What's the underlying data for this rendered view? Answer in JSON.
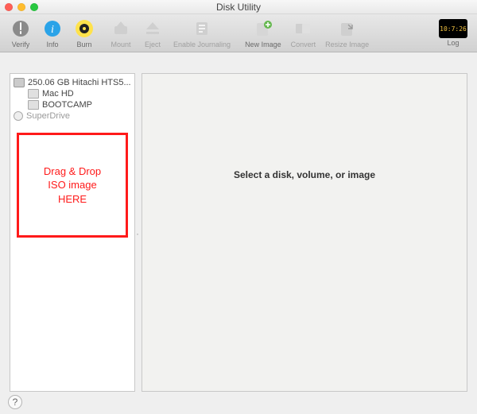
{
  "window": {
    "title": "Disk Utility"
  },
  "toolbar": {
    "verify": "Verify",
    "info": "Info",
    "burn": "Burn",
    "mount": "Mount",
    "eject": "Eject",
    "enable_journaling": "Enable Journaling",
    "new_image": "New Image",
    "convert": "Convert",
    "resize_image": "Resize Image",
    "log": "Log",
    "log_badge": "10:7:26"
  },
  "sidebar": {
    "disk": "250.06 GB Hitachi HTS5...",
    "volumes": [
      "Mac HD",
      "BOOTCAMP"
    ],
    "superdrive": "SuperDrive"
  },
  "dropzone": "Drag & Drop\nISO image\nHERE",
  "main": {
    "placeholder": "Select a disk, volume, or image"
  },
  "help": "?"
}
